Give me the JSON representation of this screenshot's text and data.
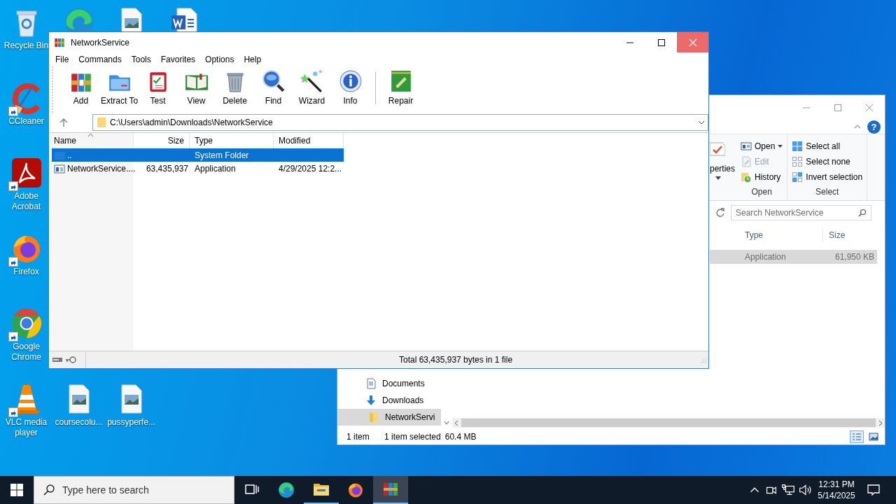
{
  "desktop_icons": [
    {
      "label": "Recycle Bin",
      "kind": "recycle"
    },
    {
      "kind": "edge"
    },
    {
      "kind": "image"
    },
    {
      "kind": "word"
    },
    {
      "label": "CCleaner",
      "kind": "ccleaner",
      "shortcut": true
    },
    {
      "label": "Adobe Acrobat",
      "kind": "acrobat",
      "shortcut": true
    },
    {
      "label": "Firefox",
      "kind": "firefox",
      "shortcut": true
    },
    {
      "label": "Google Chrome",
      "kind": "chrome",
      "shortcut": true
    },
    {
      "label": "VLC media player",
      "kind": "vlc",
      "shortcut": true
    },
    {
      "label": "coursecolu...",
      "kind": "image"
    },
    {
      "label": "pussyperfe...",
      "kind": "image"
    }
  ],
  "explorer": {
    "help": "?",
    "ribbon": {
      "partial_label": "perties",
      "groups": [
        {
          "title": "Open",
          "items": [
            {
              "label": "Open",
              "kind": "open",
              "dropdown": true,
              "disabled": false
            },
            {
              "label": "Edit",
              "kind": "edit",
              "disabled": true
            },
            {
              "label": "History",
              "kind": "history",
              "disabled": false
            }
          ]
        },
        {
          "title": "Select",
          "items": [
            {
              "label": "Select all",
              "kind": "select_all",
              "disabled": false
            },
            {
              "label": "Select none",
              "kind": "select_none",
              "disabled": false
            },
            {
              "label": "Invert selection",
              "kind": "invert",
              "disabled": false
            }
          ]
        }
      ]
    },
    "search": {
      "placeholder": "Search NetworkService"
    },
    "columns": [
      "Type",
      "Size"
    ],
    "rows": [
      {
        "type": "Application",
        "size": "61,950 KB",
        "selected": true
      }
    ],
    "nav": [
      {
        "label": "Documents",
        "kind": "documents",
        "selected": false
      },
      {
        "label": "Downloads",
        "kind": "downloads",
        "selected": false
      },
      {
        "label": "NetworkServi",
        "kind": "folder",
        "selected": true
      }
    ],
    "status": {
      "count": "1 item",
      "selection": "1 item selected",
      "size": "60.4 MB"
    }
  },
  "winrar": {
    "title": "NetworkService",
    "menu": [
      "File",
      "Commands",
      "Tools",
      "Favorites",
      "Options",
      "Help"
    ],
    "toolbar": [
      {
        "label": "Add",
        "kind": "add"
      },
      {
        "label": "Extract To",
        "kind": "extract"
      },
      {
        "label": "Test",
        "kind": "test"
      },
      {
        "label": "View",
        "kind": "view"
      },
      {
        "label": "Delete",
        "kind": "delete"
      },
      {
        "label": "Find",
        "kind": "find"
      },
      {
        "label": "Wizard",
        "kind": "wizard"
      },
      {
        "label": "Info",
        "kind": "info"
      },
      {
        "label": "Repair",
        "kind": "repair",
        "separator_before": true
      }
    ],
    "address": {
      "path": "C:\\Users\\admin\\Downloads\\NetworkService"
    },
    "columns": [
      {
        "label": "Name",
        "sorted": true
      },
      {
        "label": "Size",
        "sorted": false
      },
      {
        "label": "Type",
        "sorted": false
      },
      {
        "label": "Modified",
        "sorted": false
      }
    ],
    "rows": [
      {
        "kind": "parent",
        "name": "..",
        "type": "System Folder",
        "selected": true
      },
      {
        "kind": "exe",
        "name": "NetworkService....",
        "size": "63,435,937",
        "type": "Application",
        "modified": "4/29/2025 12:2...",
        "selected": false
      }
    ],
    "status": "Total 63,435,937 bytes in 1 file"
  },
  "taskbar": {
    "search_placeholder": "Type here to search",
    "apps": [
      {
        "kind": "taskview",
        "running": false,
        "selected": false
      },
      {
        "kind": "edge",
        "running": false,
        "selected": false
      },
      {
        "kind": "explorer",
        "running": true,
        "selected": false
      },
      {
        "kind": "firefox",
        "running": false,
        "selected": false
      },
      {
        "kind": "winrar",
        "running": true,
        "selected": true
      }
    ],
    "tray": [
      {
        "kind": "chevron"
      },
      {
        "kind": "meet"
      },
      {
        "kind": "network"
      },
      {
        "kind": "volume"
      }
    ],
    "time": "12:31 PM",
    "date": "5/14/2025"
  }
}
